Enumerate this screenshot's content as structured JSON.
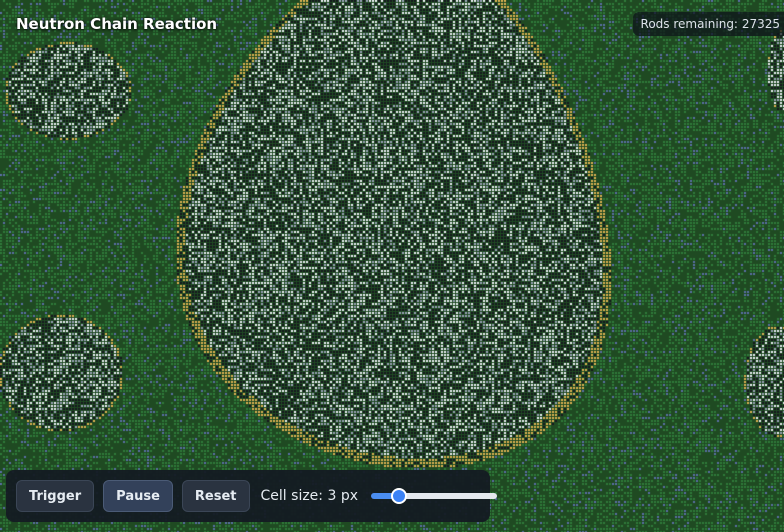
{
  "app": {
    "title": "Neutron Chain Reaction"
  },
  "status": {
    "rods_label": "Rods remaining:",
    "rods_count": "27325"
  },
  "controls": {
    "trigger_label": "Trigger",
    "pause_label": "Pause",
    "reset_label": "Reset",
    "cell_size_prefix": "Cell size:",
    "cell_size_value": "3",
    "cell_size_unit": "px",
    "cell_size_slider_min": "1",
    "cell_size_slider_max": "12",
    "cell_size_slider_value": "3"
  },
  "colors": {
    "background": "#1f4a22",
    "unreacted_rod": "#2f7a3a",
    "spent_rod": "#16171f",
    "reacting_front": "#e0b352",
    "neutron": "#f0f2f8",
    "accent": "#3b82f6"
  }
}
